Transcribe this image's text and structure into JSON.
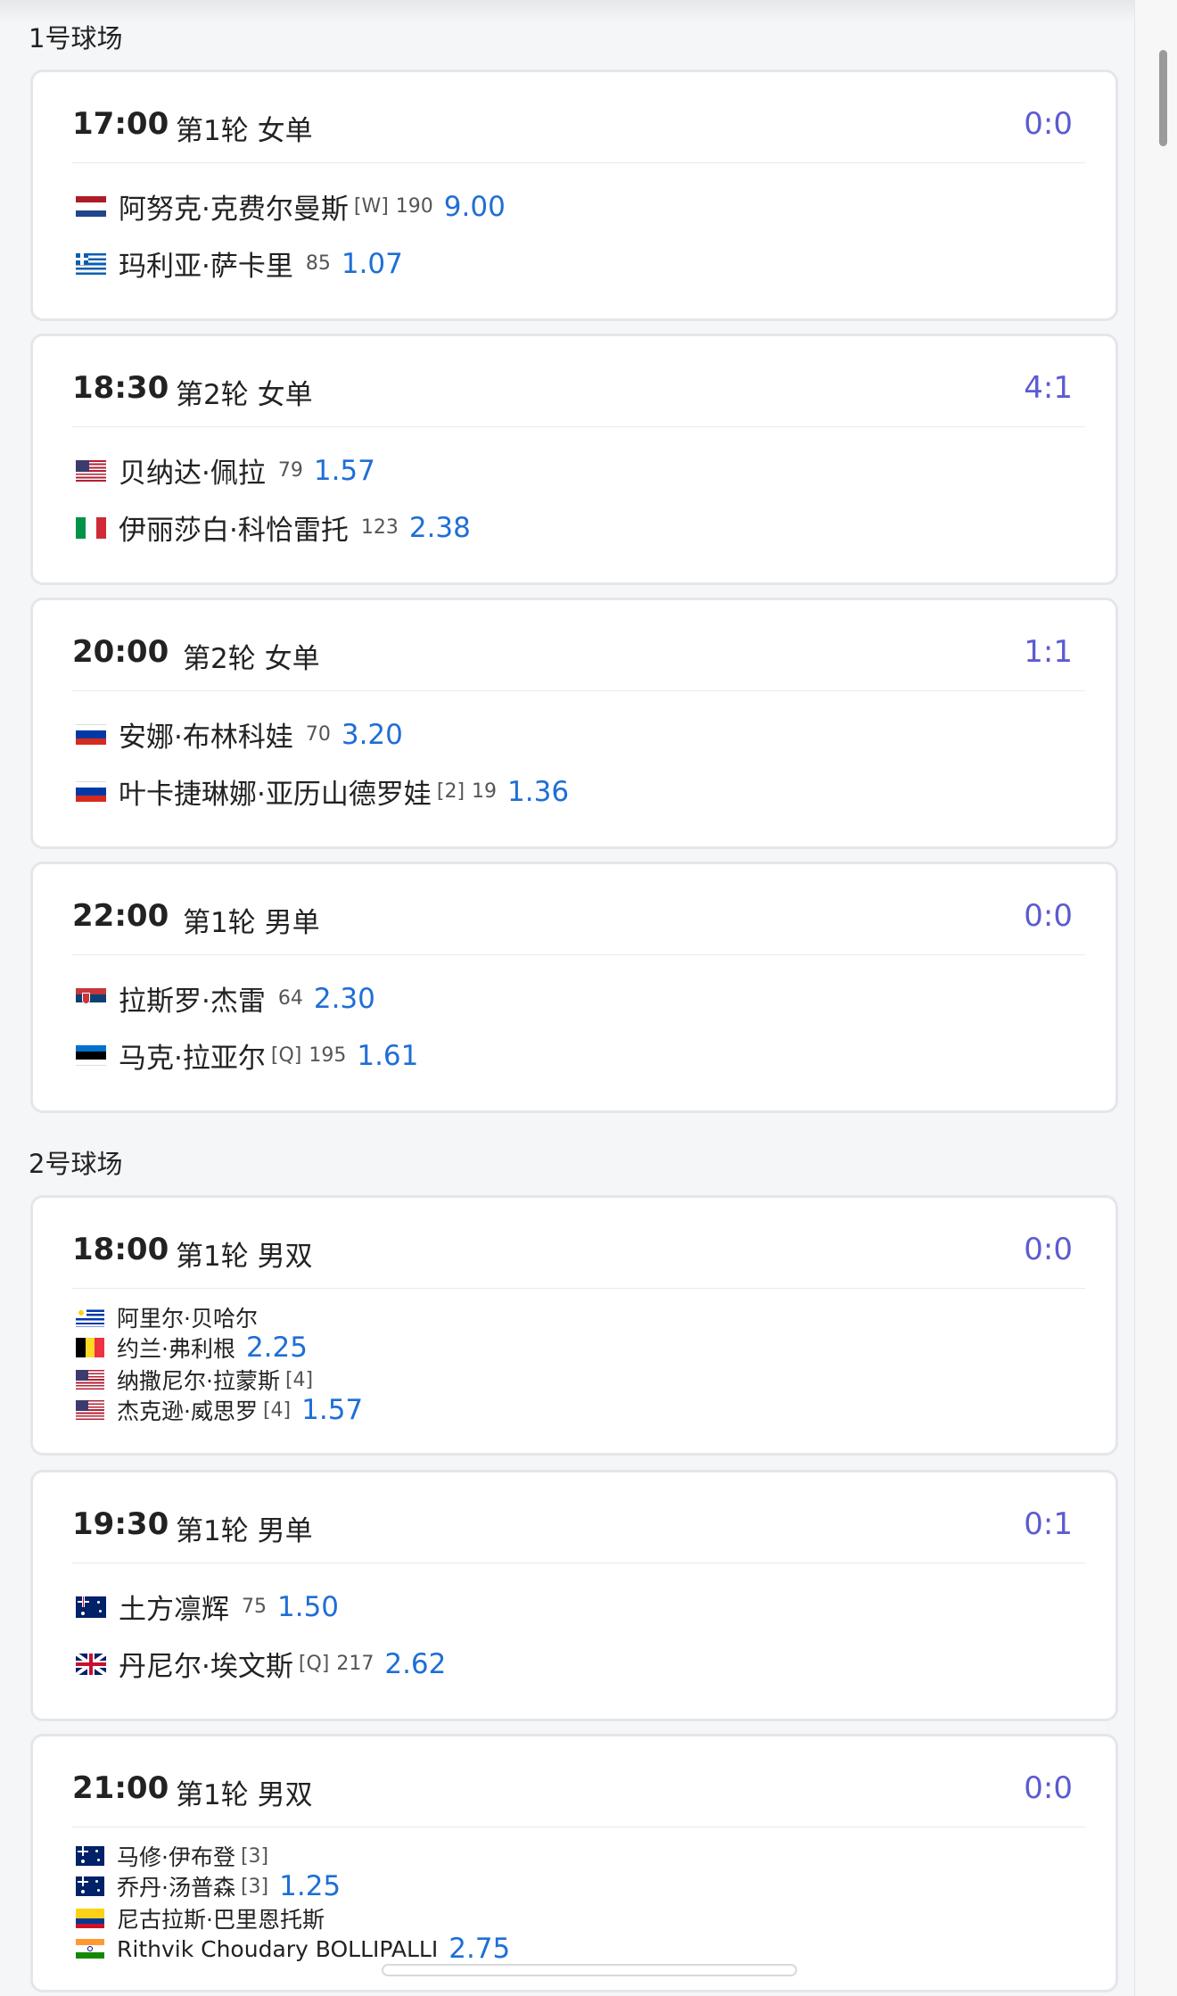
{
  "courts": [
    {
      "title": "1号球场",
      "matches": [
        {
          "time": "17:00",
          "round": "第1轮 女单",
          "score": "0:0",
          "players": [
            {
              "flag": "nl",
              "name": "阿努克·克费尔曼斯",
              "seed": "[W]",
              "rank": "190",
              "odds": "9.00"
            },
            {
              "flag": "gr",
              "name": "玛利亚·萨卡里",
              "seed": "",
              "rank": "85",
              "odds": "1.07"
            }
          ]
        },
        {
          "time": "18:30",
          "round": "第2轮 女单",
          "score": "4:1",
          "players": [
            {
              "flag": "us",
              "name": "贝纳达·佩拉",
              "seed": "",
              "rank": "79",
              "odds": "1.57"
            },
            {
              "flag": "it",
              "name": "伊丽莎白·科恰雷托",
              "seed": "",
              "rank": "123",
              "odds": "2.38"
            }
          ]
        },
        {
          "time": "20:00",
          "round": "第2轮 女单",
          "score": "1:1",
          "players": [
            {
              "flag": "ru",
              "name": "安娜·布林科娃",
              "seed": "",
              "rank": "70",
              "odds": "3.20"
            },
            {
              "flag": "ru",
              "name": "叶卡捷琳娜·亚历山德罗娃",
              "seed": "[2]",
              "rank": "19",
              "odds": "1.36"
            }
          ]
        },
        {
          "time": "22:00",
          "round": "第1轮 男单",
          "score": "0:0",
          "players": [
            {
              "flag": "rs",
              "name": "拉斯罗·杰雷",
              "seed": "",
              "rank": "64",
              "odds": "2.30"
            },
            {
              "flag": "ee",
              "name": "马克·拉亚尔",
              "seed": "[Q]",
              "rank": "195",
              "odds": "1.61"
            }
          ]
        }
      ]
    },
    {
      "title": "2号球场",
      "matches": [
        {
          "time": "18:00",
          "round": "第1轮 男双",
          "score": "0:0",
          "players": [
            {
              "flag": "uy",
              "name": "阿里尔·贝哈尔",
              "seed": "",
              "rank": "",
              "odds": ""
            },
            {
              "flag": "be",
              "name": "约兰·弗利根",
              "seed": "",
              "rank": "",
              "odds": "2.25"
            },
            {
              "flag": "us",
              "name": "纳撒尼尔·拉蒙斯",
              "seed": "[4]",
              "rank": "",
              "odds": ""
            },
            {
              "flag": "us",
              "name": "杰克逊·威思罗",
              "seed": "[4]",
              "rank": "",
              "odds": "1.57"
            }
          ]
        },
        {
          "time": "19:30",
          "round": "第1轮 男单",
          "score": "0:1",
          "players": [
            {
              "flag": "au",
              "name": "土方凛辉",
              "seed": "",
              "rank": "75",
              "odds": "1.50"
            },
            {
              "flag": "gb",
              "name": "丹尼尔·埃文斯",
              "seed": "[Q]",
              "rank": "217",
              "odds": "2.62"
            }
          ]
        },
        {
          "time": "21:00",
          "round": "第1轮 男双",
          "score": "0:0",
          "players": [
            {
              "flag": "au",
              "name": "马修·伊布登",
              "seed": "[3]",
              "rank": "",
              "odds": ""
            },
            {
              "flag": "au",
              "name": "乔丹·汤普森",
              "seed": "[3]",
              "rank": "",
              "odds": "1.25"
            },
            {
              "flag": "co",
              "name": "尼古拉斯·巴里恩托斯",
              "seed": "",
              "rank": "",
              "odds": ""
            },
            {
              "flag": "in",
              "name": "Rithvik Choudary BOLLIPALLI",
              "seed": "",
              "rank": "",
              "odds": "2.75"
            }
          ]
        }
      ]
    }
  ]
}
